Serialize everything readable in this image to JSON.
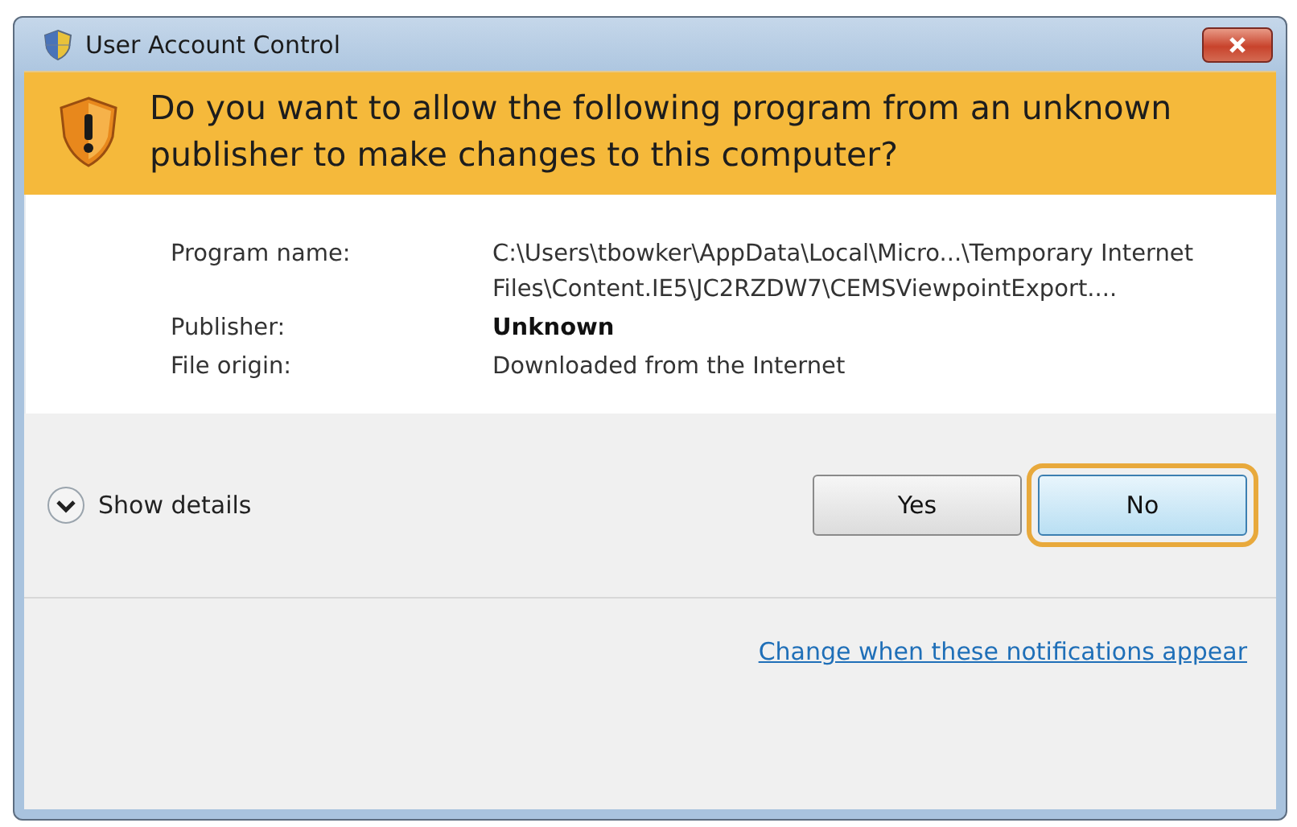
{
  "window": {
    "title": "User Account Control"
  },
  "banner": {
    "question": "Do you want to allow the following program from an unknown publisher to make changes to this computer?"
  },
  "details": [
    {
      "label": "Program name:",
      "value": "C:\\Users\\tbowker\\AppData\\Local\\Micro...\\Temporary Internet Files\\Content.IE5\\JC2RZDW7\\CEMSViewpointExport....",
      "bold": false
    },
    {
      "label": "Publisher:",
      "value": "Unknown",
      "bold": true
    },
    {
      "label": "File origin:",
      "value": "Downloaded from the Internet",
      "bold": false
    }
  ],
  "show_details": {
    "label": "Show details",
    "expanded": false
  },
  "buttons": [
    {
      "label": "Yes",
      "selected": false
    },
    {
      "label": "No",
      "selected": true
    }
  ],
  "link": "Change when these notifications appear"
}
